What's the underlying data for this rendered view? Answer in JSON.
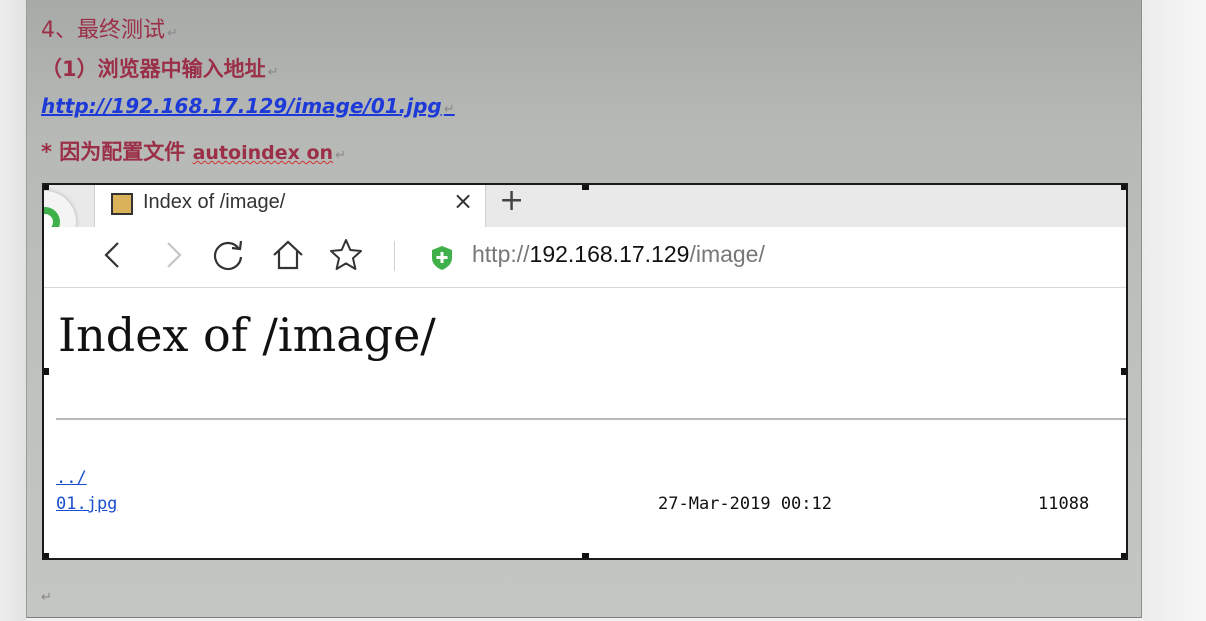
{
  "document": {
    "line1": "4、最终测试",
    "line2": "（1）浏览器中输入地址",
    "line3_link": "http://192.168.17.129/image/01.jpg",
    "line4_prefix": "* 因为配置文件 ",
    "line4_code": "autoindex on",
    "para_mark": "↵"
  },
  "browser": {
    "tab_title": "Index of /image/",
    "tab_close": "×",
    "new_tab": "+",
    "url_scheme": "http://",
    "url_host": "192.168.17.129",
    "url_path": "/image/",
    "icons": [
      "back-icon",
      "forward-icon",
      "reload-icon",
      "home-icon",
      "star-icon",
      "shield-icon"
    ]
  },
  "page": {
    "heading": "Index of /image/",
    "rows": [
      {
        "name": "../",
        "date": "",
        "size": ""
      },
      {
        "name": "01.jpg",
        "date": "27-Mar-2019 00:12",
        "size": "11088"
      }
    ]
  },
  "colors": {
    "doc_text": "#9b2f47",
    "doc_link": "#1d3ad9",
    "page_link": "#1b4fd0",
    "shield_green": "#3fb04a"
  }
}
